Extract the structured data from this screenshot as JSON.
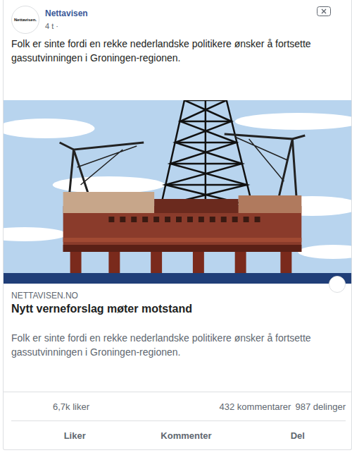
{
  "post": {
    "page_name": "Nettavisen",
    "logo_text": "Nettavisen.",
    "time": "4 t ·",
    "text": "Folk er sinte fordi en rekke nederlandske politikere ønsker å fortsette gassutvinningen i Groningen-regionen."
  },
  "link": {
    "domain": "NETTAVISEN.NO",
    "title": "Nytt verneforslag møter motstand",
    "description": "Folk er sinte fordi en rekke nederlandske politikere ønsker å fortsette gassutvinningen i Groningen-regionen."
  },
  "stats": {
    "likes": "6,7k liker",
    "comments": "432 kommentarer",
    "shares": "987 delinger"
  },
  "actions": [
    {
      "label": "Liker"
    },
    {
      "label": "Kommenter"
    },
    {
      "label": "Del"
    }
  ]
}
